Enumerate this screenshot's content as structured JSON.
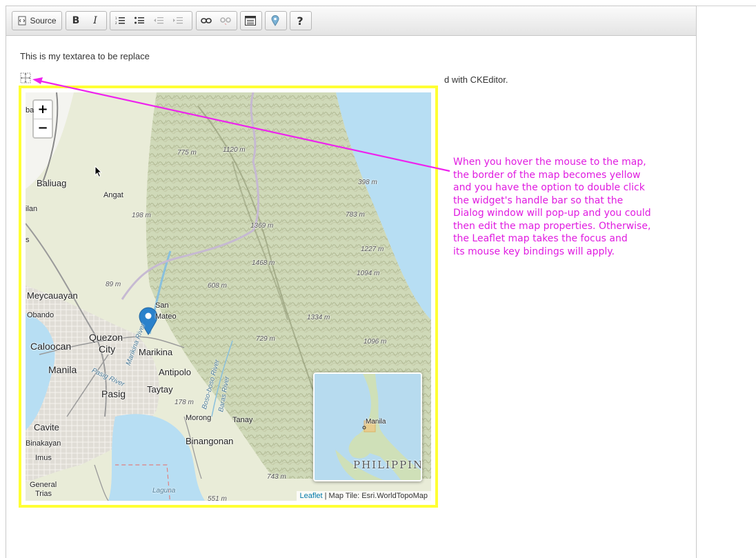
{
  "toolbar": {
    "source_label": "Source",
    "bold_label": "B",
    "italic_label": "I",
    "help_label": "?"
  },
  "content": {
    "paragraph_start": "This is my textarea to be replace",
    "paragraph_end": "d with CKEditor."
  },
  "map": {
    "zoom_in": "+",
    "zoom_out": "−",
    "attribution_link": "Leaflet",
    "attribution_text": " | Map Tile: Esri.WorldTopoMap",
    "minimap_labels": {
      "city": "Manila",
      "country": "PHILIPPIN"
    },
    "place_labels": {
      "baliuag": "Baliuag",
      "angat": "Angat",
      "ilan": "ilan",
      "meycauayan": "Meycauayan",
      "obando": "Obando",
      "caloocan": "Caloocan",
      "quezon": "Quezon",
      "city": "City",
      "manila": "Manila",
      "san": "San",
      "mateo": "Mateo",
      "marikina": "Marikina",
      "antipolo": "Antipolo",
      "taytay": "Taytay",
      "pasig": "Pasig",
      "cavite": "Cavite",
      "binakayan": "Binakayan",
      "imus": "Imus",
      "general": "General",
      "trias": "Trias",
      "morong": "Morong",
      "tanay": "Tanay",
      "binangonan": "Binangonan",
      "laguna": "Laguna",
      "ba": "ba",
      "s": "s"
    },
    "elevations": {
      "e775": "775 m",
      "e1120": "1120 m",
      "e398": "398 m",
      "e198": "198 m",
      "e783": "783 m",
      "e1369": "1369 m",
      "e1227": "1227 m",
      "e1468": "1468 m",
      "e1094": "1094 m",
      "e89": "89 m",
      "e608": "608 m",
      "e1334": "1334 m",
      "e729": "729 m",
      "e1096": "1096 m",
      "e178": "178 m",
      "e743": "743 m",
      "e551": "551 m"
    },
    "rivers": {
      "r1": "Marikina River",
      "r2": "Pasig River",
      "r3": "Boso-boso River",
      "r4": "Baras River"
    }
  },
  "annotation": {
    "lines": [
      "When you hover the mouse to the map,",
      "the border of the map becomes yellow",
      "and you have the option to double click",
      "the widget's handle bar so that the",
      "Dialog window will pop-up and you could",
      "then edit the map properties. Otherwise,",
      "the Leaflet map takes the focus and",
      "its mouse key bindings will apply."
    ]
  },
  "colors": {
    "widget_border": "#ffff33",
    "annotation": "#e01ce0",
    "marker": "#2a81cb"
  }
}
